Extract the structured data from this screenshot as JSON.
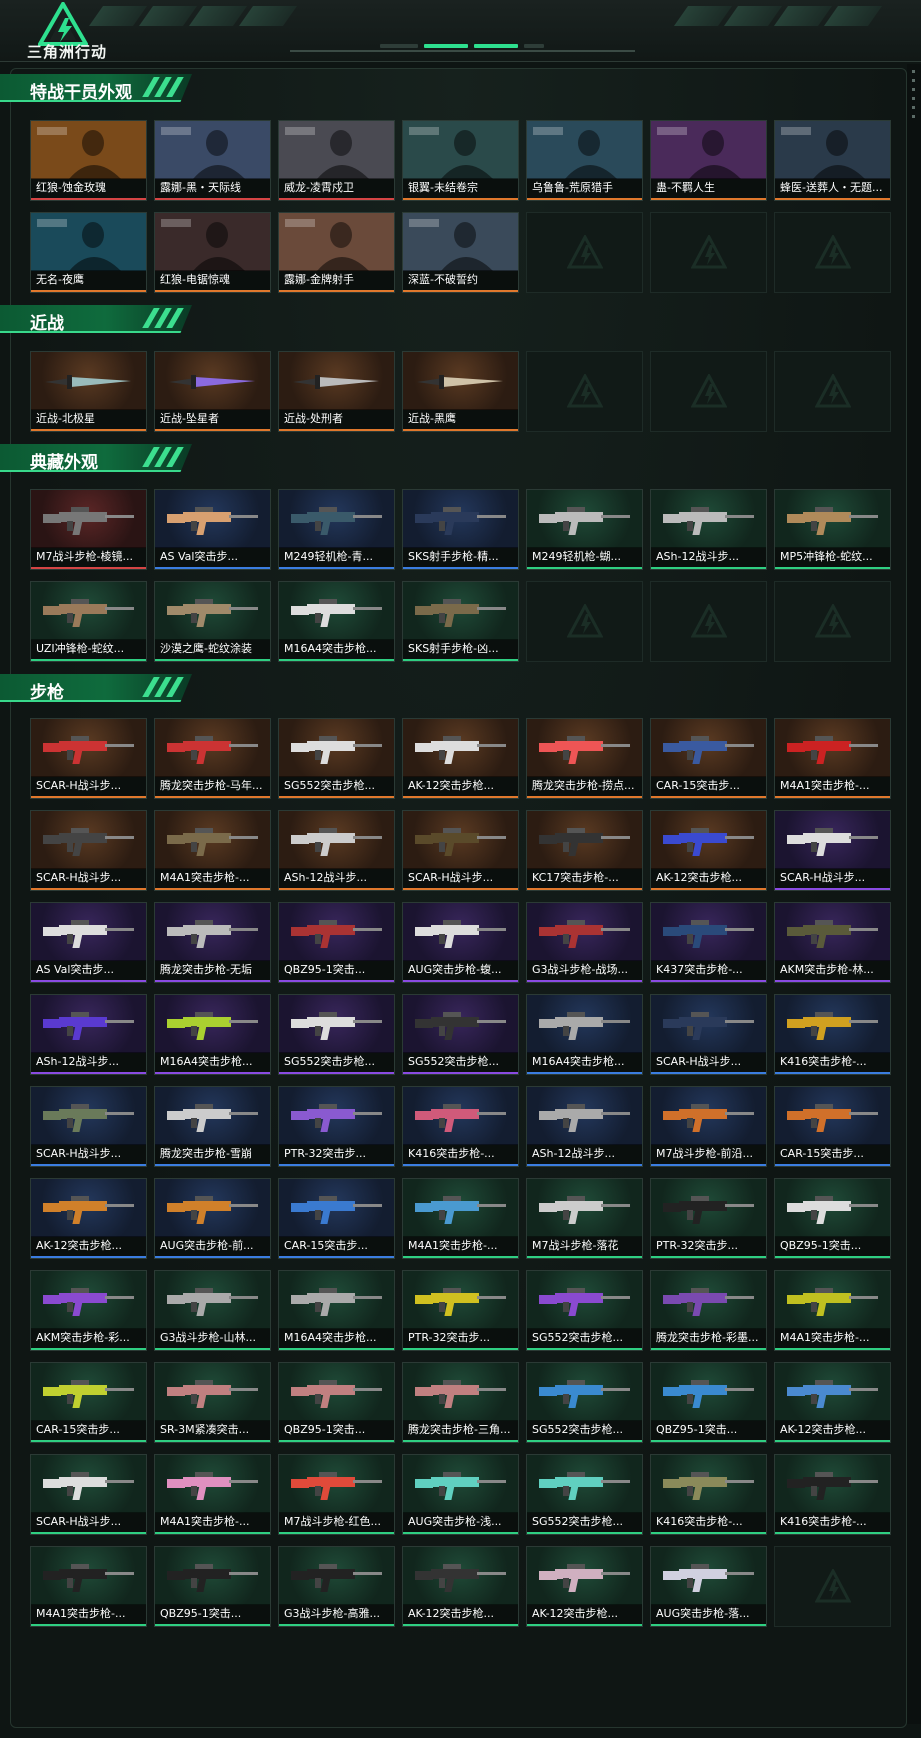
{
  "app": {
    "title": "三角洲行动"
  },
  "colors": {
    "accent": "#2ee08f",
    "orange": "#e0782d",
    "red": "#d54545",
    "blue": "#3b7de0",
    "purple": "#8a4be2",
    "green": "#2fcf82"
  },
  "sections": [
    {
      "title": "特战干员外观",
      "items": [
        {
          "label": "红狼-蚀金玫瑰",
          "rarity": "red",
          "kind": "portrait",
          "tint": "#7a4a1a"
        },
        {
          "label": "露娜-黑・天际线",
          "rarity": "red",
          "kind": "portrait",
          "tint": "#3a4a66"
        },
        {
          "label": "威龙-凌霄戍卫",
          "rarity": "red",
          "kind": "portrait",
          "tint": "#4a4a52"
        },
        {
          "label": "银翼-未结卷宗",
          "rarity": "orange",
          "kind": "portrait",
          "tint": "#2a4a4a"
        },
        {
          "label": "乌鲁鲁-荒原猎手",
          "rarity": "orange",
          "kind": "portrait",
          "tint": "#2a4a5a"
        },
        {
          "label": "蛊-不羁人生",
          "rarity": "orange",
          "kind": "portrait",
          "tint": "#4a2a5a"
        },
        {
          "label": "蜂医-送葬人・无题...",
          "rarity": "orange",
          "kind": "portrait",
          "tint": "#2a3a4a"
        },
        {
          "label": "无名-夜鹰",
          "rarity": "orange",
          "kind": "portrait",
          "tint": "#1a4a5a"
        },
        {
          "label": "红狼-电锯惊魂",
          "rarity": "orange",
          "kind": "portrait",
          "tint": "#3a2a2a"
        },
        {
          "label": "露娜-金牌射手",
          "rarity": "orange",
          "kind": "portrait",
          "tint": "#6a4a3a"
        },
        {
          "label": "深蓝-不破誓约",
          "rarity": "orange",
          "kind": "portrait",
          "tint": "#3a4a5a"
        },
        {
          "label": "",
          "rarity": "empty"
        },
        {
          "label": "",
          "rarity": "empty"
        },
        {
          "label": "",
          "rarity": "empty"
        }
      ]
    },
    {
      "title": "近战",
      "items": [
        {
          "label": "近战-北极星",
          "rarity": "orange",
          "kind": "blade",
          "tint": "#9bb"
        },
        {
          "label": "近战-坠星者",
          "rarity": "orange",
          "kind": "blade",
          "tint": "#8a6adf"
        },
        {
          "label": "近战-处刑者",
          "rarity": "orange",
          "kind": "blade",
          "tint": "#bbb"
        },
        {
          "label": "近战-黑鹰",
          "rarity": "orange",
          "kind": "blade",
          "tint": "#cfc2a8"
        },
        {
          "label": "",
          "rarity": "empty"
        },
        {
          "label": "",
          "rarity": "empty"
        },
        {
          "label": "",
          "rarity": "empty"
        }
      ]
    },
    {
      "title": "典藏外观",
      "items": [
        {
          "label": "M7战斗步枪-棱镜...",
          "rarity": "red",
          "kind": "gun",
          "tint": "#777"
        },
        {
          "label": "AS Val突击步...",
          "rarity": "blue",
          "kind": "gun",
          "tint": "#d8a070"
        },
        {
          "label": "M249轻机枪-青...",
          "rarity": "blue",
          "kind": "gun",
          "tint": "#3a5a6a"
        },
        {
          "label": "SKS射手步枪-精...",
          "rarity": "blue",
          "kind": "gun",
          "tint": "#2a3a5a"
        },
        {
          "label": "M249轻机枪-蝴...",
          "rarity": "green",
          "kind": "gun",
          "tint": "#bbb"
        },
        {
          "label": "ASh-12战斗步...",
          "rarity": "green",
          "kind": "gun",
          "tint": "#bbb"
        },
        {
          "label": "MP5冲锋枪-蛇纹...",
          "rarity": "green",
          "kind": "gun",
          "tint": "#b08a5a"
        },
        {
          "label": "UZI冲锋枪-蛇纹...",
          "rarity": "green",
          "kind": "gun",
          "tint": "#9a7a5a"
        },
        {
          "label": "沙漠之鹰-蛇纹涂装",
          "rarity": "green",
          "kind": "gun",
          "tint": "#a08a6a"
        },
        {
          "label": "M16A4突击步枪...",
          "rarity": "green",
          "kind": "gun",
          "tint": "#ddd"
        },
        {
          "label": "SKS射手步枪-凶...",
          "rarity": "green",
          "kind": "gun",
          "tint": "#7a6a4a"
        },
        {
          "label": "",
          "rarity": "empty"
        },
        {
          "label": "",
          "rarity": "empty"
        },
        {
          "label": "",
          "rarity": "empty"
        }
      ]
    },
    {
      "title": "步枪",
      "items": [
        {
          "label": "SCAR-H战斗步...",
          "rarity": "orange",
          "kind": "gun",
          "tint": "#c33"
        },
        {
          "label": "腾龙突击步枪-马年...",
          "rarity": "orange",
          "kind": "gun",
          "tint": "#c33"
        },
        {
          "label": "SG552突击步枪...",
          "rarity": "orange",
          "kind": "gun",
          "tint": "#ddd"
        },
        {
          "label": "AK-12突击步枪...",
          "rarity": "orange",
          "kind": "gun",
          "tint": "#ddd"
        },
        {
          "label": "腾龙突击步枪-捞点...",
          "rarity": "orange",
          "kind": "gun",
          "tint": "#e55"
        },
        {
          "label": "CAR-15突击步...",
          "rarity": "orange",
          "kind": "gun",
          "tint": "#3a5aa0"
        },
        {
          "label": "M4A1突击步枪-...",
          "rarity": "orange",
          "kind": "gun",
          "tint": "#c22"
        },
        {
          "label": "SCAR-H战斗步...",
          "rarity": "orange",
          "kind": "gun",
          "tint": "#444"
        },
        {
          "label": "M4A1突击步枪-...",
          "rarity": "orange",
          "kind": "gun",
          "tint": "#7a6a4a"
        },
        {
          "label": "ASh-12战斗步...",
          "rarity": "orange",
          "kind": "gun",
          "tint": "#ccc"
        },
        {
          "label": "SCAR-H战斗步...",
          "rarity": "orange",
          "kind": "gun",
          "tint": "#5a4a2a"
        },
        {
          "label": "KC17突击步枪-...",
          "rarity": "orange",
          "kind": "gun",
          "tint": "#333"
        },
        {
          "label": "AK-12突击步枪...",
          "rarity": "orange",
          "kind": "gun",
          "tint": "#3a4ad0"
        },
        {
          "label": "SCAR-H战斗步...",
          "rarity": "purple",
          "kind": "gun",
          "tint": "#ddd"
        },
        {
          "label": "AS Val突击步...",
          "rarity": "purple",
          "kind": "gun",
          "tint": "#ddd"
        },
        {
          "label": "腾龙突击步枪-无垢",
          "rarity": "purple",
          "kind": "gun",
          "tint": "#bbb"
        },
        {
          "label": "QBZ95-1突击...",
          "rarity": "purple",
          "kind": "gun",
          "tint": "#a33"
        },
        {
          "label": "AUG突击步枪-蝮...",
          "rarity": "purple",
          "kind": "gun",
          "tint": "#ddd"
        },
        {
          "label": "G3战斗步枪-战场...",
          "rarity": "purple",
          "kind": "gun",
          "tint": "#a33"
        },
        {
          "label": "K437突击步枪-...",
          "rarity": "purple",
          "kind": "gun",
          "tint": "#2a4a7a"
        },
        {
          "label": "AKM突击步枪-林...",
          "rarity": "purple",
          "kind": "gun",
          "tint": "#5a5a3a"
        },
        {
          "label": "ASh-12战斗步...",
          "rarity": "purple",
          "kind": "gun",
          "tint": "#5a3ad0"
        },
        {
          "label": "M16A4突击步枪...",
          "rarity": "purple",
          "kind": "gun",
          "tint": "#aad030"
        },
        {
          "label": "SG552突击步枪...",
          "rarity": "purple",
          "kind": "gun",
          "tint": "#ddd"
        },
        {
          "label": "SG552突击步枪...",
          "rarity": "purple",
          "kind": "gun",
          "tint": "#333"
        },
        {
          "label": "M16A4突击步枪...",
          "rarity": "blue",
          "kind": "gun",
          "tint": "#aaa"
        },
        {
          "label": "SCAR-H战斗步...",
          "rarity": "blue",
          "kind": "gun",
          "tint": "#2a3a5a"
        },
        {
          "label": "K416突击步枪-...",
          "rarity": "blue",
          "kind": "gun",
          "tint": "#d0a020"
        },
        {
          "label": "SCAR-H战斗步...",
          "rarity": "blue",
          "kind": "gun",
          "tint": "#6a7a5a"
        },
        {
          "label": "腾龙突击步枪-雪崩",
          "rarity": "blue",
          "kind": "gun",
          "tint": "#ccc"
        },
        {
          "label": "PTR-32突击步...",
          "rarity": "blue",
          "kind": "gun",
          "tint": "#8a5ad0"
        },
        {
          "label": "K416突击步枪-...",
          "rarity": "blue",
          "kind": "gun",
          "tint": "#d05a7a"
        },
        {
          "label": "ASh-12战斗步...",
          "rarity": "blue",
          "kind": "gun",
          "tint": "#aaa"
        },
        {
          "label": "M7战斗步枪-前沿...",
          "rarity": "blue",
          "kind": "gun",
          "tint": "#d0702a"
        },
        {
          "label": "CAR-15突击步...",
          "rarity": "blue",
          "kind": "gun",
          "tint": "#d0702a"
        },
        {
          "label": "AK-12突击步枪...",
          "rarity": "blue",
          "kind": "gun",
          "tint": "#d0802a"
        },
        {
          "label": "AUG突击步枪-前...",
          "rarity": "blue",
          "kind": "gun",
          "tint": "#d0802a"
        },
        {
          "label": "CAR-15突击步...",
          "rarity": "blue",
          "kind": "gun",
          "tint": "#3a7ad0"
        },
        {
          "label": "M4A1突击步枪-...",
          "rarity": "green",
          "kind": "gun",
          "tint": "#4a9ad0"
        },
        {
          "label": "M7战斗步枪-落花",
          "rarity": "green",
          "kind": "gun",
          "tint": "#ccc"
        },
        {
          "label": "PTR-32突击步...",
          "rarity": "green",
          "kind": "gun",
          "tint": "#222"
        },
        {
          "label": "QBZ95-1突击...",
          "rarity": "green",
          "kind": "gun",
          "tint": "#ddd"
        },
        {
          "label": "AKM突击步枪-彩...",
          "rarity": "green",
          "kind": "gun",
          "tint": "#8a4ad0"
        },
        {
          "label": "G3战斗步枪-山林...",
          "rarity": "green",
          "kind": "gun",
          "tint": "#aaa"
        },
        {
          "label": "M16A4突击步枪...",
          "rarity": "green",
          "kind": "gun",
          "tint": "#aaa"
        },
        {
          "label": "PTR-32突击步...",
          "rarity": "green",
          "kind": "gun",
          "tint": "#d0c020"
        },
        {
          "label": "SG552突击步枪...",
          "rarity": "green",
          "kind": "gun",
          "tint": "#8a4ad0"
        },
        {
          "label": "腾龙突击步枪-彩墨...",
          "rarity": "green",
          "kind": "gun",
          "tint": "#7a4ab0"
        },
        {
          "label": "M4A1突击步枪-...",
          "rarity": "green",
          "kind": "gun",
          "tint": "#c0c020"
        },
        {
          "label": "CAR-15突击步...",
          "rarity": "green",
          "kind": "gun",
          "tint": "#c0d030"
        },
        {
          "label": "SR-3M紧凑突击...",
          "rarity": "green",
          "kind": "gun",
          "tint": "#c08080"
        },
        {
          "label": "QBZ95-1突击...",
          "rarity": "green",
          "kind": "gun",
          "tint": "#c08080"
        },
        {
          "label": "腾龙突击步枪-三角...",
          "rarity": "green",
          "kind": "gun",
          "tint": "#c08080"
        },
        {
          "label": "SG552突击步枪...",
          "rarity": "green",
          "kind": "gun",
          "tint": "#3a8ad0"
        },
        {
          "label": "QBZ95-1突击...",
          "rarity": "green",
          "kind": "gun",
          "tint": "#3a8ad0"
        },
        {
          "label": "AK-12突击步枪...",
          "rarity": "green",
          "kind": "gun",
          "tint": "#4a8ad0"
        },
        {
          "label": "SCAR-H战斗步...",
          "rarity": "green",
          "kind": "gun",
          "tint": "#ddd"
        },
        {
          "label": "M4A1突击步枪-...",
          "rarity": "green",
          "kind": "gun",
          "tint": "#e090c0"
        },
        {
          "label": "M7战斗步枪-红色...",
          "rarity": "green",
          "kind": "gun",
          "tint": "#e04a3a"
        },
        {
          "label": "AUG突击步枪-浅...",
          "rarity": "green",
          "kind": "gun",
          "tint": "#60d0c0"
        },
        {
          "label": "SG552突击步枪...",
          "rarity": "green",
          "kind": "gun",
          "tint": "#60d0c0"
        },
        {
          "label": "K416突击步枪-...",
          "rarity": "green",
          "kind": "gun",
          "tint": "#8a8a5a"
        },
        {
          "label": "K416突击步枪-...",
          "rarity": "green",
          "kind": "gun",
          "tint": "#222"
        },
        {
          "label": "M4A1突击步枪-...",
          "rarity": "green",
          "kind": "gun",
          "tint": "#222"
        },
        {
          "label": "QBZ95-1突击...",
          "rarity": "green",
          "kind": "gun",
          "tint": "#222"
        },
        {
          "label": "G3战斗步枪-高雅...",
          "rarity": "green",
          "kind": "gun",
          "tint": "#222"
        },
        {
          "label": "AK-12突击步枪...",
          "rarity": "green",
          "kind": "gun",
          "tint": "#333"
        },
        {
          "label": "AK-12突击步枪...",
          "rarity": "green",
          "kind": "gun",
          "tint": "#d0b0c0"
        },
        {
          "label": "AUG突击步枪-落...",
          "rarity": "green",
          "kind": "gun",
          "tint": "#d0d0e0"
        },
        {
          "label": "",
          "rarity": "empty"
        }
      ]
    }
  ]
}
